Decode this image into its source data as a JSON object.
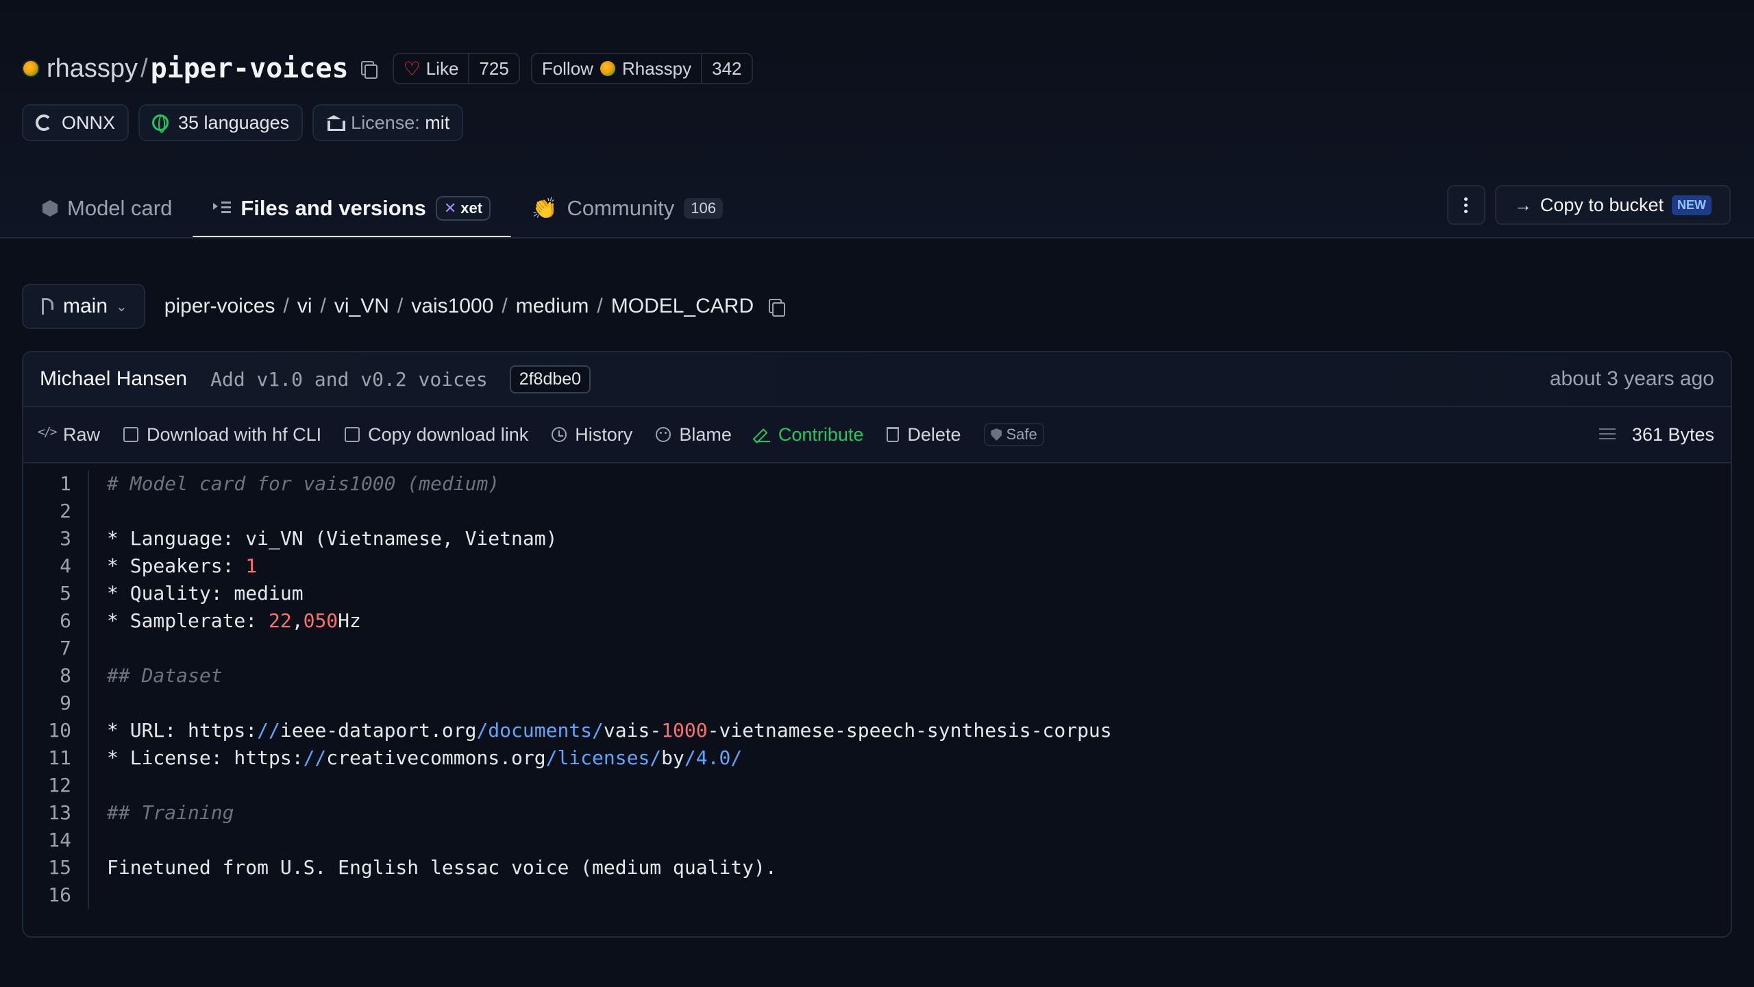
{
  "repo": {
    "org": "rhasspy",
    "name": "piper-voices",
    "like_label": "Like",
    "like_count": "725",
    "follow_label": "Follow",
    "follow_org": "Rhasspy",
    "follow_count": "342"
  },
  "tags": {
    "format": "ONNX",
    "languages": "35 languages",
    "license_label": "License:",
    "license_value": "mit"
  },
  "tabs": {
    "model_card": "Model card",
    "files": "Files and versions",
    "xet": "xet",
    "community": "Community",
    "community_count": "106"
  },
  "actions": {
    "copy_to_bucket": "Copy to bucket",
    "new_badge": "NEW"
  },
  "branch": {
    "name": "main",
    "path": [
      "piper-voices",
      "vi",
      "vi_VN",
      "vais1000",
      "medium",
      "MODEL_CARD"
    ]
  },
  "commit": {
    "author": "Michael Hansen",
    "message": "Add v1.0 and v0.2 voices",
    "hash": "2f8dbe0",
    "time": "about 3 years ago"
  },
  "file_actions": {
    "raw": "Raw",
    "download_cli": "Download with hf CLI",
    "copy_link": "Copy download link",
    "history": "History",
    "blame": "Blame",
    "contribute": "Contribute",
    "delete": "Delete",
    "safe": "Safe",
    "size": "361 Bytes"
  },
  "code": {
    "line_numbers": [
      "1",
      "2",
      "3",
      "4",
      "5",
      "6",
      "7",
      "8",
      "9",
      "10",
      "11",
      "12",
      "13",
      "14",
      "15",
      "16"
    ],
    "l1": "# Model card for vais1000 (medium)",
    "l3": "* Language: vi_VN (Vietnamese, Vietnam)",
    "l4_prefix": "* Speakers: ",
    "l4_num": "1",
    "l5": "* Quality: medium",
    "l6_prefix": "* Samplerate: ",
    "l6_n1": "22",
    "l6_comma": ",",
    "l6_n2": "050",
    "l6_suffix": "Hz",
    "l8": "## Dataset",
    "l10_a": "* URL: https:",
    "l10_b": "//",
    "l10_c": "ieee-dataport.org",
    "l10_d": "/documents/",
    "l10_e": "vais-",
    "l10_f": "1000",
    "l10_g": "-vietnamese-speech-synthesis-corpus",
    "l11_a": "* License: https:",
    "l11_b": "//",
    "l11_c": "creativecommons.org",
    "l11_d": "/licenses/",
    "l11_e": "by",
    "l11_f": "/4.0/",
    "l13": "## Training",
    "l15": "Finetuned from U.S. English lessac voice (medium quality)."
  }
}
